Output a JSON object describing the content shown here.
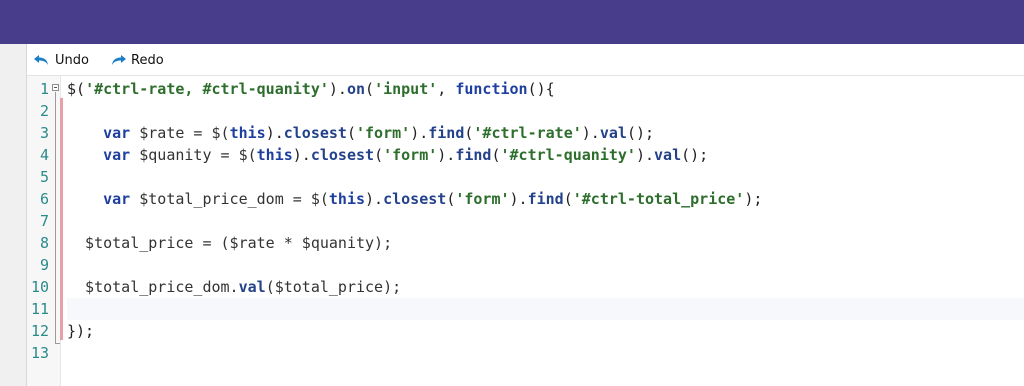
{
  "toolbar": {
    "undo_label": "Undo",
    "redo_label": "Redo",
    "undo_icon": "undo-arrow-icon",
    "redo_icon": "redo-arrow-icon"
  },
  "colors": {
    "titlebar": "#483d8b",
    "keyword": "#1f3fa0",
    "string": "#2d6e2d",
    "line_number": "#2b8a8a",
    "change_marker": "#e8a0a8"
  },
  "editor": {
    "line_numbers": [
      "1",
      "2",
      "3",
      "4",
      "5",
      "6",
      "7",
      "8",
      "9",
      "10",
      "11",
      "12",
      "13"
    ],
    "current_line": 11,
    "lines": [
      [
        {
          "t": "$(",
          "c": "op"
        },
        {
          "t": "'#ctrl-rate, #ctrl-quanity'",
          "c": "str"
        },
        {
          "t": ").",
          "c": "op"
        },
        {
          "t": "on",
          "c": "fn"
        },
        {
          "t": "(",
          "c": "op"
        },
        {
          "t": "'input'",
          "c": "str"
        },
        {
          "t": ", ",
          "c": "op"
        },
        {
          "t": "function",
          "c": "kw"
        },
        {
          "t": "(){",
          "c": "op"
        }
      ],
      [],
      [
        {
          "t": "    ",
          "c": "op"
        },
        {
          "t": "var",
          "c": "kw"
        },
        {
          "t": " $rate = $(",
          "c": "var"
        },
        {
          "t": "this",
          "c": "kw"
        },
        {
          "t": ").",
          "c": "op"
        },
        {
          "t": "closest",
          "c": "fn"
        },
        {
          "t": "(",
          "c": "op"
        },
        {
          "t": "'form'",
          "c": "str"
        },
        {
          "t": ").",
          "c": "op"
        },
        {
          "t": "find",
          "c": "fn"
        },
        {
          "t": "(",
          "c": "op"
        },
        {
          "t": "'#ctrl-rate'",
          "c": "str"
        },
        {
          "t": ").",
          "c": "op"
        },
        {
          "t": "val",
          "c": "fn"
        },
        {
          "t": "();",
          "c": "op"
        }
      ],
      [
        {
          "t": "    ",
          "c": "op"
        },
        {
          "t": "var",
          "c": "kw"
        },
        {
          "t": " $quanity = $(",
          "c": "var"
        },
        {
          "t": "this",
          "c": "kw"
        },
        {
          "t": ").",
          "c": "op"
        },
        {
          "t": "closest",
          "c": "fn"
        },
        {
          "t": "(",
          "c": "op"
        },
        {
          "t": "'form'",
          "c": "str"
        },
        {
          "t": ").",
          "c": "op"
        },
        {
          "t": "find",
          "c": "fn"
        },
        {
          "t": "(",
          "c": "op"
        },
        {
          "t": "'#ctrl-quanity'",
          "c": "str"
        },
        {
          "t": ").",
          "c": "op"
        },
        {
          "t": "val",
          "c": "fn"
        },
        {
          "t": "();",
          "c": "op"
        }
      ],
      [],
      [
        {
          "t": "    ",
          "c": "op"
        },
        {
          "t": "var",
          "c": "kw"
        },
        {
          "t": " $total_price_dom = $(",
          "c": "var"
        },
        {
          "t": "this",
          "c": "kw"
        },
        {
          "t": ").",
          "c": "op"
        },
        {
          "t": "closest",
          "c": "fn"
        },
        {
          "t": "(",
          "c": "op"
        },
        {
          "t": "'form'",
          "c": "str"
        },
        {
          "t": ").",
          "c": "op"
        },
        {
          "t": "find",
          "c": "fn"
        },
        {
          "t": "(",
          "c": "op"
        },
        {
          "t": "'#ctrl-total_price'",
          "c": "str"
        },
        {
          "t": ");",
          "c": "op"
        }
      ],
      [],
      [
        {
          "t": "  $total_price = ($rate * $quanity);",
          "c": "var"
        }
      ],
      [],
      [
        {
          "t": "  $total_price_dom.",
          "c": "var"
        },
        {
          "t": "val",
          "c": "fn"
        },
        {
          "t": "($total_price);",
          "c": "var"
        }
      ],
      [],
      [
        {
          "t": "});",
          "c": "op"
        }
      ],
      []
    ]
  }
}
